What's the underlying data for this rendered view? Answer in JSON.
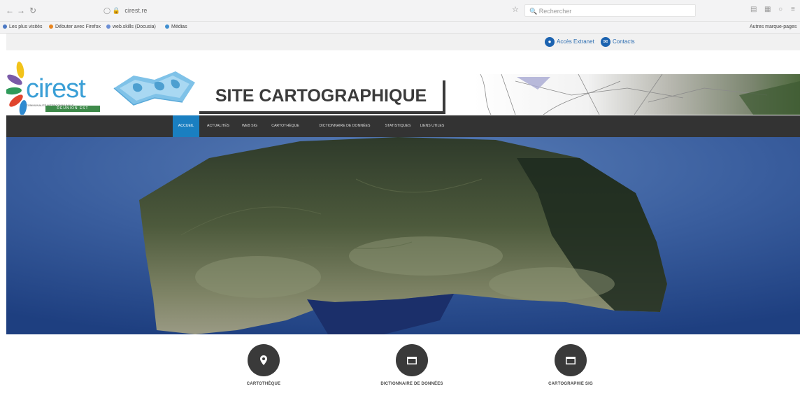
{
  "browser": {
    "url": "cirest.re",
    "search_placeholder": "Rechercher",
    "bookmarks": [
      "Les plus visités",
      "Débuter avec Firefox",
      "web.skills (Docusia)",
      "Médias"
    ],
    "other_bookmarks": "Autres marque-pages"
  },
  "site": {
    "top_links": [
      {
        "label": "Accès Extranet",
        "icon": "user-icon"
      },
      {
        "label": "Contacts",
        "icon": "mail-icon"
      }
    ],
    "logo": {
      "name": "cirest",
      "tagline": "COMMUNAUTÉ INTERCOMMUNALE",
      "band": "RÉUNION EST"
    },
    "title": "SITE CARTOGRAPHIQUE",
    "menu": [
      {
        "label": "ACCUEIL",
        "active": true
      },
      {
        "label": "ACTUALITÉS",
        "active": false
      },
      {
        "label": "WEB SIG",
        "active": false
      },
      {
        "label": "CARTOTHÈQUE",
        "active": false
      },
      {
        "label": "DICTIONNAIRE DE DONNÉES",
        "active": false
      },
      {
        "label": "STATISTIQUES",
        "active": false
      },
      {
        "label": "LIENS UTILES",
        "active": false
      }
    ],
    "features": [
      {
        "label": "CARTOTHÈQUE",
        "icon": "map-pin-icon"
      },
      {
        "label": "DICTIONNAIRE DE DONNÉES",
        "icon": "window-icon"
      },
      {
        "label": "CARTOGRAPHIE SIG",
        "icon": "window-icon"
      }
    ],
    "colors": {
      "accent": "#1a7fc1",
      "menu_bg": "#333333",
      "logo_blue": "#3a9fd6",
      "logo_band": "#3e8a4a"
    }
  }
}
